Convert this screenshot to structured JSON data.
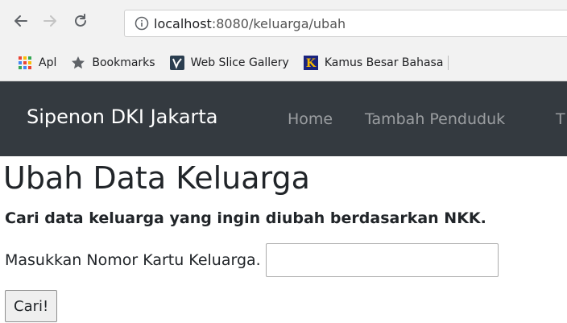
{
  "browser": {
    "url_host": "localhost",
    "url_path": ":8080/keluarga/ubah",
    "bookmarks": [
      {
        "label": "Apl",
        "icon": "apps-grid-icon"
      },
      {
        "label": "Bookmarks",
        "icon": "star-icon"
      },
      {
        "label": "Web Slice Gallery",
        "icon": "web-slice-icon"
      },
      {
        "label": "Kamus Besar Bahasa",
        "icon": "kbbi-k-icon"
      }
    ]
  },
  "navbar": {
    "brand": "Sipenon DKI Jakarta",
    "links": [
      "Home",
      "Tambah Penduduk",
      "T"
    ]
  },
  "page": {
    "title": "Ubah Data Keluarga",
    "subtitle": "Cari data keluarga yang ingin diubah berdasarkan NKK.",
    "nkk_label": "Masukkan Nomor Kartu Keluarga.",
    "nkk_value": "",
    "search_button": "Cari!"
  }
}
